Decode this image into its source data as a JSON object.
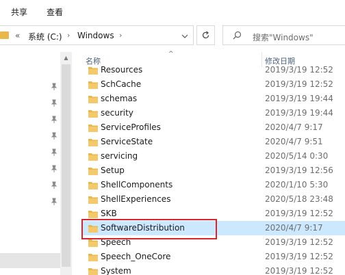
{
  "ribbon": {
    "tabs": [
      "共享",
      "查看"
    ]
  },
  "address": {
    "overflow": "«",
    "crumbs": [
      "系统 (C:)",
      "Windows"
    ]
  },
  "search": {
    "placeholder": "搜索\"Windows\""
  },
  "columns": {
    "name": "名称",
    "date": "修改日期"
  },
  "files": [
    {
      "name": "Resources",
      "date": "2019/3/19 12:52"
    },
    {
      "name": "SchCache",
      "date": "2019/3/19 12:52"
    },
    {
      "name": "schemas",
      "date": "2019/3/19 19:44"
    },
    {
      "name": "security",
      "date": "2019/3/19 19:44"
    },
    {
      "name": "ServiceProfiles",
      "date": "2020/4/7 9:17"
    },
    {
      "name": "ServiceState",
      "date": "2020/4/7 9:51"
    },
    {
      "name": "servicing",
      "date": "2020/5/14 0:30"
    },
    {
      "name": "Setup",
      "date": "2019/3/19 12:56"
    },
    {
      "name": "ShellComponents",
      "date": "2020/1/10 5:30"
    },
    {
      "name": "ShellExperiences",
      "date": "2020/5/18 23:48"
    },
    {
      "name": "SKB",
      "date": "2019/3/19 12:52"
    },
    {
      "name": "SoftwareDistribution",
      "date": "2020/4/7 9:17",
      "selected": true
    },
    {
      "name": "Speech",
      "date": "2019/3/19 12:52"
    },
    {
      "name": "Speech_OneCore",
      "date": "2019/3/19 12:52"
    },
    {
      "name": "System",
      "date": "2019/3/19 12:52"
    }
  ],
  "colors": {
    "folder": "#e8b84a",
    "selection": "#cce8ff",
    "highlight": "#d9232e"
  }
}
